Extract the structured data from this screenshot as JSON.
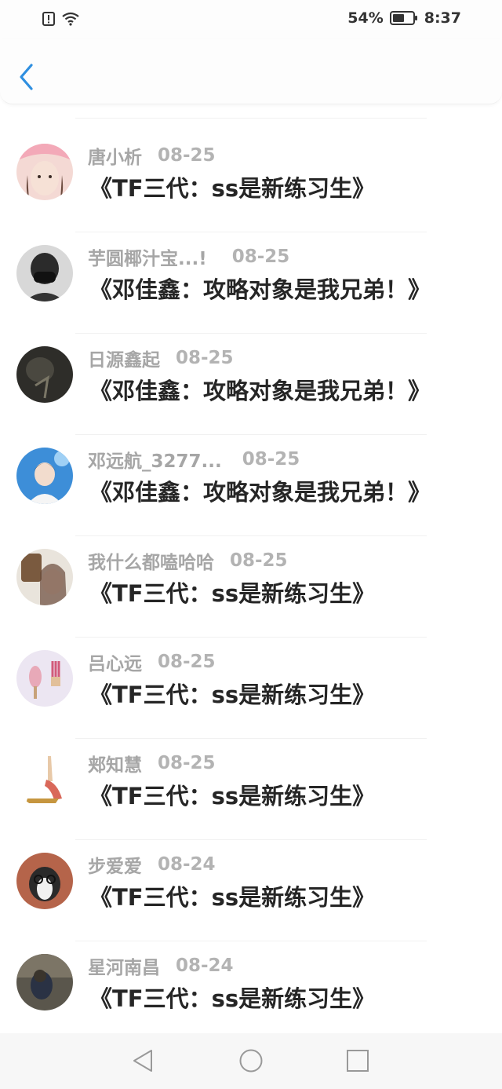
{
  "status": {
    "battery": "54%",
    "time": "8:37"
  },
  "header": {
    "back_icon": "chevron-left-icon",
    "accent": "#2f8fe0"
  },
  "comments": [
    {
      "user": "唐小析",
      "date": "08-25",
      "title": "《TF三代：ss是新练习生》"
    },
    {
      "user": "芋圆椰汁宝...!",
      "date": "08-25",
      "title": "《邓佳鑫：攻略对象是我兄弟！》"
    },
    {
      "user": "日源鑫起",
      "date": "08-25",
      "title": "《邓佳鑫：攻略对象是我兄弟！》"
    },
    {
      "user": "邓远航_3277...",
      "date": "08-25",
      "title": "《邓佳鑫：攻略对象是我兄弟！》"
    },
    {
      "user": "我什么都嗑哈哈",
      "date": "08-25",
      "title": "《TF三代：ss是新练习生》"
    },
    {
      "user": "吕心远",
      "date": "08-25",
      "title": "《TF三代：ss是新练习生》"
    },
    {
      "user": "郏知慧",
      "date": "08-25",
      "title": "《TF三代：ss是新练习生》"
    },
    {
      "user": "步爱爱",
      "date": "08-24",
      "title": "《TF三代：ss是新练习生》"
    },
    {
      "user": "星河南昌",
      "date": "08-24",
      "title": "《TF三代：ss是新练习生》"
    }
  ],
  "navbar": {
    "back": "triangle-back-icon",
    "home": "circle-home-icon",
    "recents": "square-recents-icon"
  }
}
